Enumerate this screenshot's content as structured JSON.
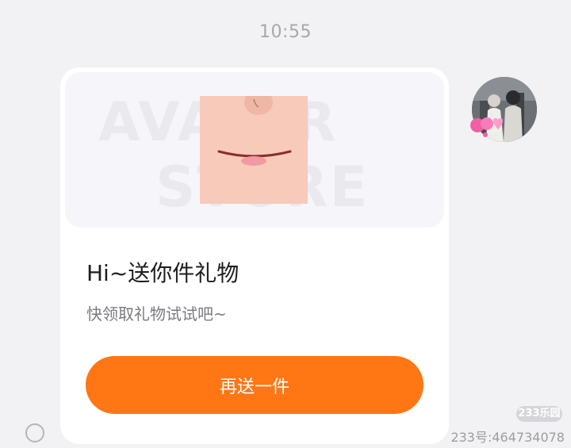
{
  "message": {
    "timestamp": "10:55"
  },
  "gift_card": {
    "banner_watermark_line1": "AVATAR",
    "banner_watermark_line2": "STORE",
    "title": "Hi~送你件礼物",
    "subtitle": "快领取礼物试试吧~",
    "cta_label": "再送一件"
  },
  "footer": {
    "logo_text": "233乐园",
    "user_id": "233号:464734078"
  },
  "colors": {
    "accent": "#ff7614",
    "background": "#f2f2f4",
    "card": "#ffffff",
    "title_text": "#1e1e22",
    "subtitle_text": "#7a7a80",
    "timestamp_text": "#a7a7ad"
  },
  "icons": {
    "status": "status-ring-icon",
    "avatar_badge": "heart-badge-icon",
    "product": "avatar-face-item"
  }
}
